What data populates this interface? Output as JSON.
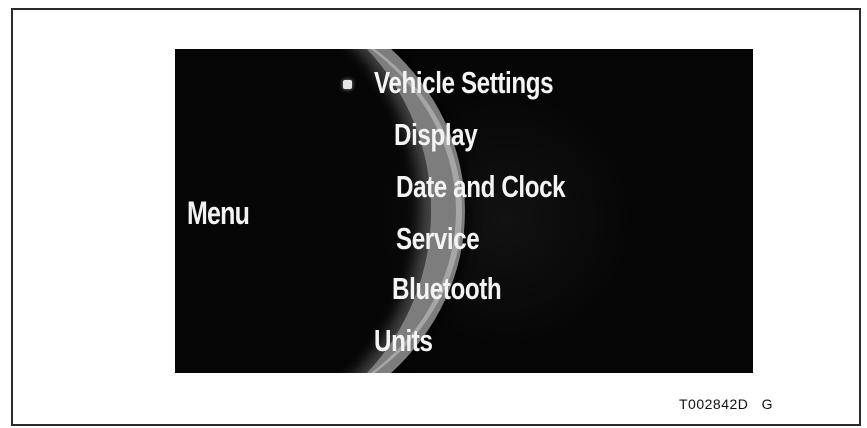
{
  "screen": {
    "title": "Menu",
    "items": [
      {
        "label": "Vehicle Settings",
        "selected": true
      },
      {
        "label": "Display",
        "selected": false
      },
      {
        "label": "Date and Clock",
        "selected": false
      },
      {
        "label": "Service",
        "selected": false
      },
      {
        "label": "Bluetooth",
        "selected": false
      },
      {
        "label": "Units",
        "selected": false
      }
    ]
  },
  "figure": {
    "code": "T002842D",
    "suffix": "G"
  },
  "colors": {
    "screen_background": "#060606",
    "text": "#f4f4f4",
    "bezel": "#7d7d7d",
    "frame": "#2a2a2a"
  }
}
